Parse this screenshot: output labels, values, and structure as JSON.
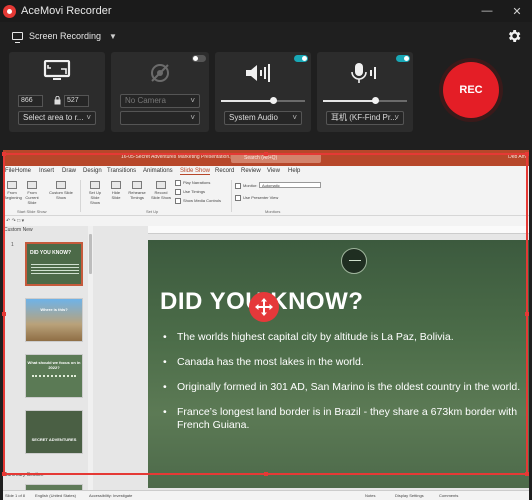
{
  "app": {
    "title": "AceMovi Recorder"
  },
  "mode": {
    "label": "Screen Recording"
  },
  "screen_panel": {
    "width": "866",
    "height": "527",
    "area_select": "Select area to r..."
  },
  "camera_panel": {
    "camera_select": "No Camera",
    "enabled": false
  },
  "audio_panel": {
    "device": "System Audio",
    "enabled": true,
    "level": 0.62
  },
  "mic_panel": {
    "device": "耳机 (KF-Find Pr...",
    "enabled": true,
    "level": 0.62
  },
  "rec_button": {
    "label": "REC"
  },
  "colors": {
    "accent_teal": "#19a8b6",
    "rec_red": "#e41e26",
    "selection_red": "#e53935",
    "ppt_brand": "#b7472a"
  },
  "ppt": {
    "doc_title": "16-05-Secret Adventures Marketing Presentation.pptx - PowerPoint",
    "search_placeholder": "Search (Alt+Q)",
    "user": "Deb Ami",
    "tabs": [
      "File",
      "Home",
      "Insert",
      "Draw",
      "Design",
      "Transitions",
      "Animations",
      "Slide Show",
      "Record",
      "Review",
      "View",
      "Help"
    ],
    "active_tab": "Slide Show",
    "ribbon": {
      "from_beginning": "From Beginning",
      "from_current": "From Current Slide",
      "custom_show": "Custom Slide Show",
      "start_group": "Start Slide Show",
      "set_up": "Set Up Slide Show",
      "hide_slide": "Hide Slide",
      "rehearse": "Rehearse Timings",
      "record": "Record Slide Show",
      "play_narrations": "Play Narrations",
      "use_timings": "Use Timings",
      "show_media": "Show Media Controls",
      "setup_group": "Set Up",
      "monitor_label": "Monitor:",
      "monitor_value": "Automatic",
      "presenter_view": "Use Presenter View",
      "monitors_group": "Monitors"
    },
    "sections": {
      "first": "Custom New",
      "second": "Summary Section"
    },
    "thumbnails": [
      {
        "num": "1",
        "title": "DID YOU KNOW?"
      },
      {
        "num": "",
        "title": "Where is this?"
      },
      {
        "num": "",
        "title": "What should we focus on in 2022?"
      },
      {
        "num": "",
        "title": "SECRET ADVENTURES"
      }
    ],
    "slide": {
      "title": "DID YOU KNOW?",
      "bullets": [
        "The worlds highest capital city by altitude is La Paz, Bolivia.",
        "Canada has the most lakes in the world.",
        "Originally formed in 301 AD, San Marino is the oldest country in the world.",
        "France’s longest land border is in Brazil -  they share a 673km border with French Guiana."
      ]
    },
    "status": {
      "slide_of": "Slide 1 of 8",
      "language": "English (United States)",
      "accessibility": "Accessibility: Investigate",
      "notes": "Notes",
      "display_settings": "Display Settings",
      "comments": "Comments"
    }
  }
}
